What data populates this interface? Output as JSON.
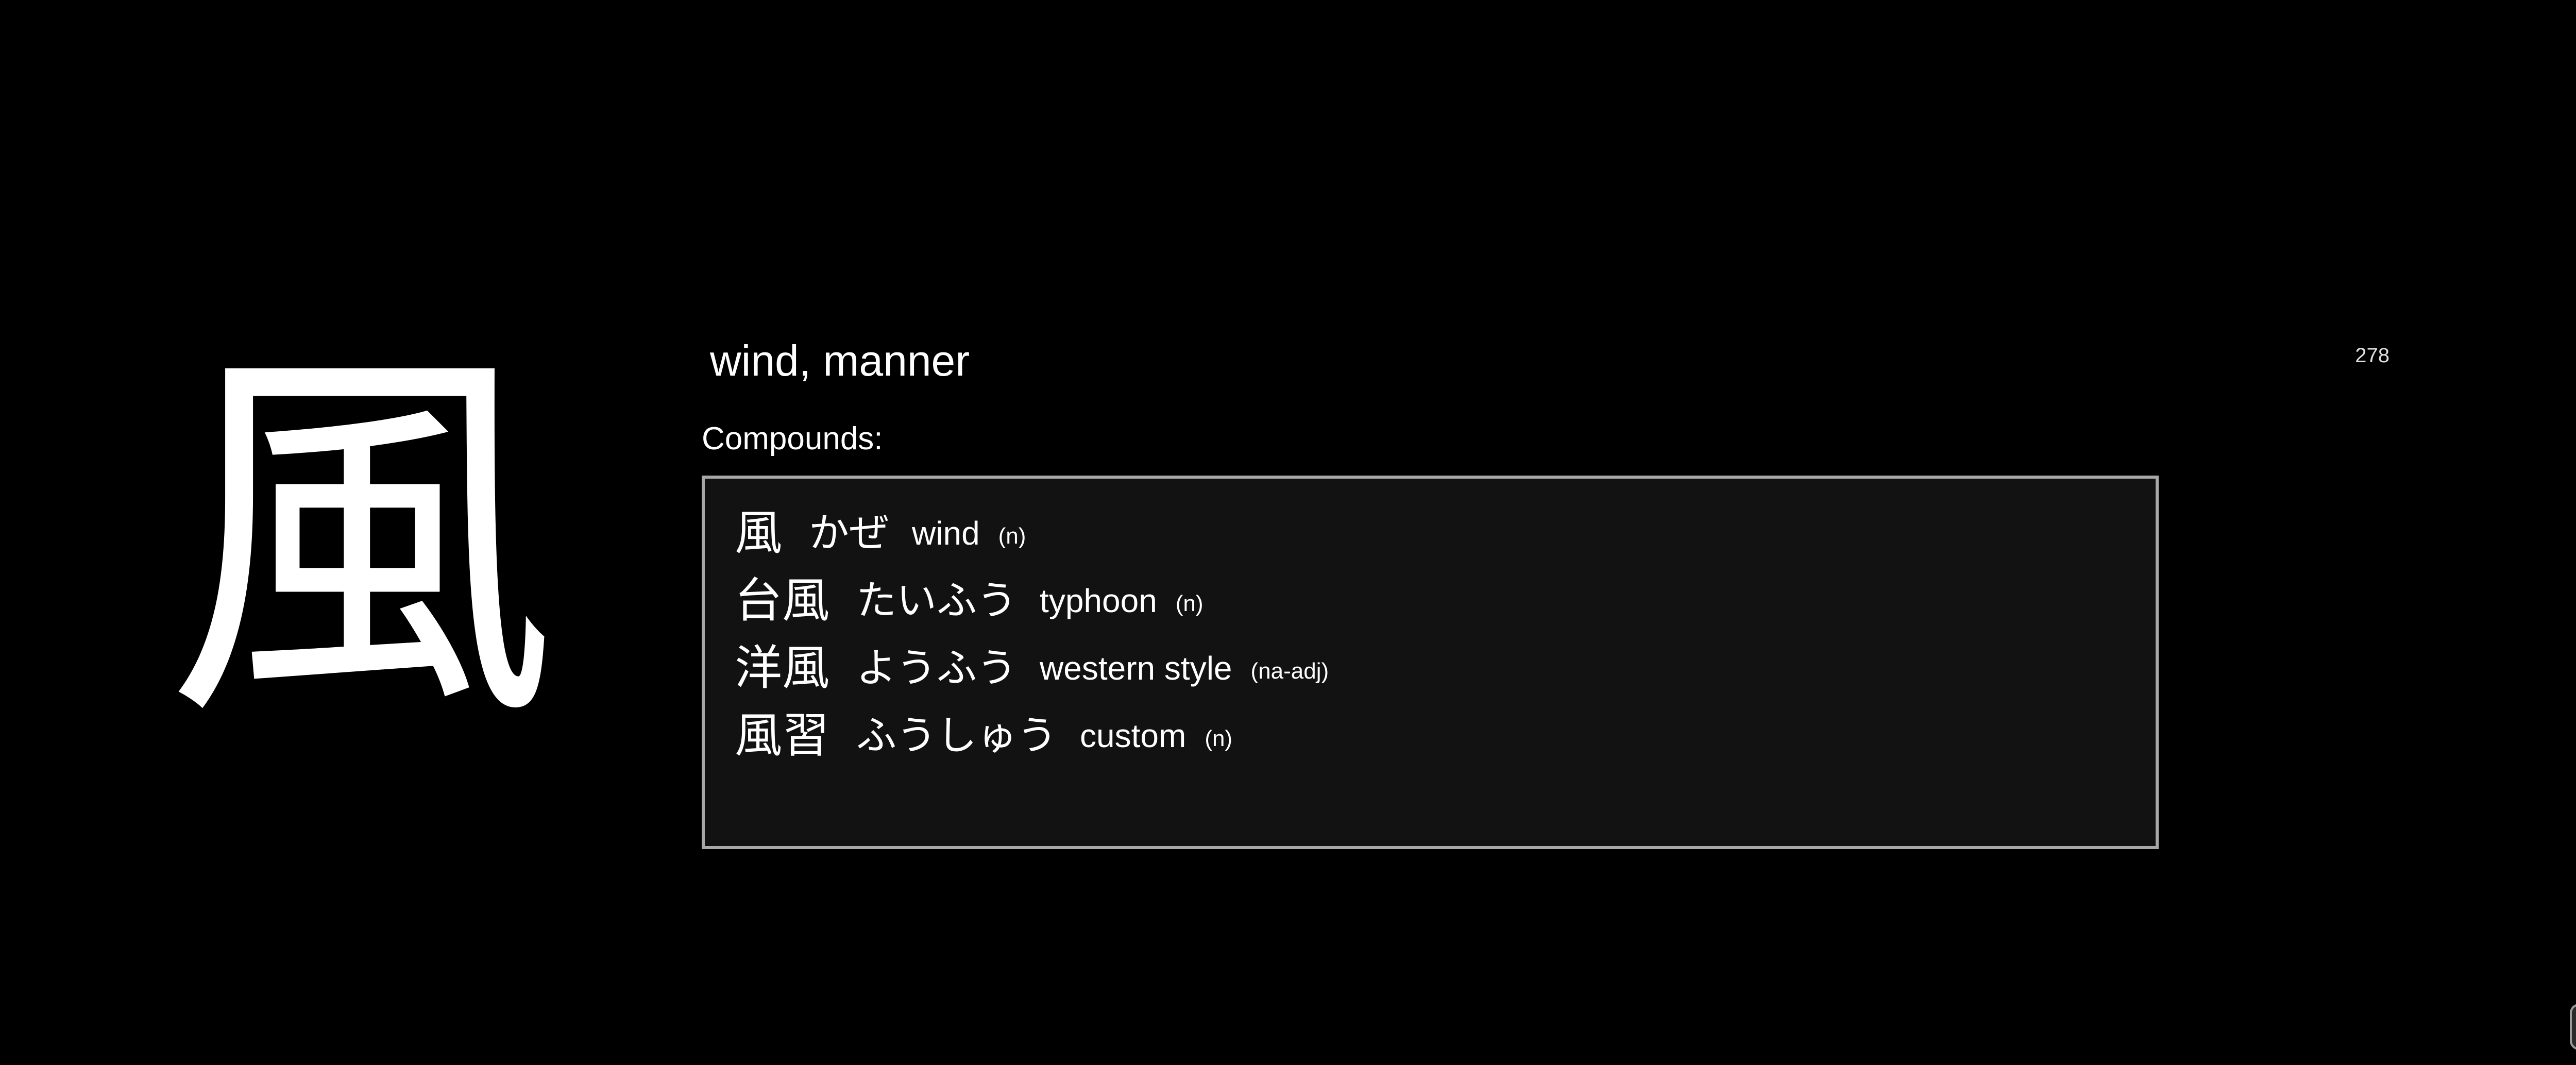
{
  "kanji": {
    "character": "風",
    "meaning": "wind, manner",
    "counter": "278"
  },
  "compounds": {
    "label": "Compounds:",
    "items": [
      {
        "word": "風",
        "reading": "かぜ",
        "meaning": "wind",
        "pos": "(n)"
      },
      {
        "word": "台風",
        "reading": "たいふう",
        "meaning": "typhoon",
        "pos": "(n)"
      },
      {
        "word": "洋風",
        "reading": "ようふう",
        "meaning": "western style",
        "pos": "(na-adj)"
      },
      {
        "word": "風習",
        "reading": "ふうしゅう",
        "meaning": "custom",
        "pos": "(n)"
      }
    ]
  },
  "colors": {
    "background": "#000000",
    "text": "#ffffff",
    "box_background": "#121212",
    "box_border": "#a8a8a8"
  }
}
